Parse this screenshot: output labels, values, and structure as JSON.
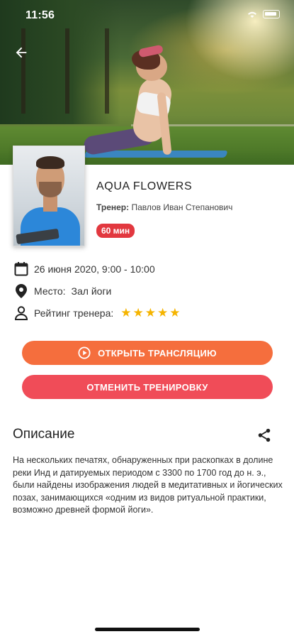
{
  "status_bar": {
    "time": "11:56"
  },
  "class": {
    "title": "AQUA FLOWERS",
    "coach_label": "Тренер:",
    "coach_name": "Павлов Иван Степанович",
    "duration": "60 мин"
  },
  "details": {
    "date": "26 июня 2020, 9:00 - 10:00",
    "place_label": "Место:",
    "place_value": "Зал йоги",
    "rating_label": "Рейтинг тренера:",
    "rating_stars": 5,
    "star_color": "#f5b400"
  },
  "buttons": {
    "stream_label": "ОТКРЫТЬ ТРАНСЛЯЦИЮ",
    "cancel_label": "ОТМЕНИТЬ ТРЕНИРОВКУ"
  },
  "description": {
    "title": "Описание",
    "text": "На нескольких печатях, обнаруженных при раскопках в долине реки Инд и датируемых периодом с 3300 по 1700 год до н. э., были найдены изображения людей в медитативных и йогических позах, занимающихся «одним из видов ритуальной практики, возможно древней формой йоги»."
  },
  "icons": {
    "back": "arrow-left-icon",
    "calendar": "calendar-icon",
    "location": "location-pin-icon",
    "person": "person-icon",
    "play": "play-circle-icon",
    "share": "share-icon",
    "star": "star-icon"
  },
  "colors": {
    "accent_orange": "#f56e3d",
    "accent_red": "#f04c58",
    "badge_red": "#e2383f"
  }
}
